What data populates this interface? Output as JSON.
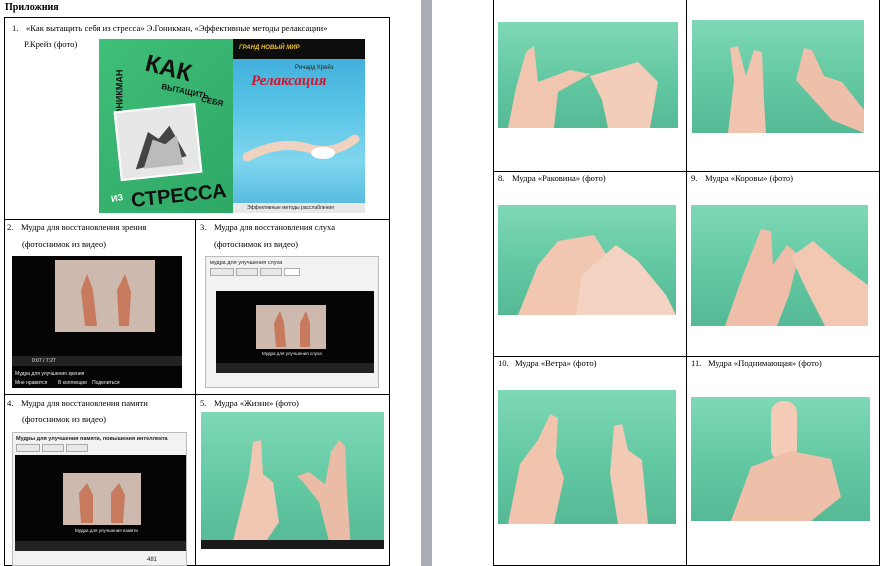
{
  "heading": "Приложния",
  "items": {
    "i1": {
      "num": "1.",
      "line1": "«Как вытащить себя из стресса» Э.Гоникман, «Эффективные методы релаксации»",
      "line2": "Р.Крейз (фото)"
    },
    "i2": {
      "num": "2.",
      "line1": "Мудра для восстановления зрения",
      "line2": "(фотоснимок из видео)"
    },
    "i3": {
      "num": "3.",
      "line1": "Мудра для восстановления слуха",
      "line2": "(фотоснимок из видео)"
    },
    "i4": {
      "num": "4.",
      "line1": "Мудра для восстановления памяти",
      "line2": "(фотоснимок из видео)"
    },
    "i5": {
      "num": "5.",
      "line1": "Мудра «Жизни» (фото)"
    },
    "i8": {
      "num": "8.",
      "line1": "Мудра «Раковина» (фото)"
    },
    "i9": {
      "num": "9.",
      "line1": "Мудра «Коровы» (фото)"
    },
    "i10": {
      "num": "10.",
      "line1": "Мудра «Ветра» (фото)"
    },
    "i11": {
      "num": "11.",
      "line1": "Мудра «Поднимающая» (фото)"
    }
  },
  "book1": {
    "author": "Э.Л.ГОНИКМАН",
    "t1": "КАК",
    "t2": "ВЫТАЩИТЬ",
    "t3": "СЕБЯ",
    "t4": "ИЗ",
    "t5": "СТРЕССА"
  },
  "book2": {
    "series": "ГРАНД НОВЫЙ МИР",
    "author": "Ричард Крейз",
    "title": "Релаксация",
    "subtitle": "Эффективные методы расслабления"
  },
  "vid2": {
    "caption": "Мудра для улучшения зрения",
    "likes": "Мне нравится",
    "coll": "В коллекции",
    "share": "Поделиться",
    "time": "0:07 / 7:27"
  },
  "vid3": {
    "title": "мудра для улучшения слуха",
    "caption": "Мудра для улучшения слуха"
  },
  "vid4": {
    "title": "Мудры для улучшения памяти, повышения интеллекта",
    "caption": "Мудра для улучшения памяти",
    "views": "481"
  },
  "colors": {
    "green": "#62c8a2",
    "page": "#ffffff",
    "bg": "#a9adb4"
  }
}
